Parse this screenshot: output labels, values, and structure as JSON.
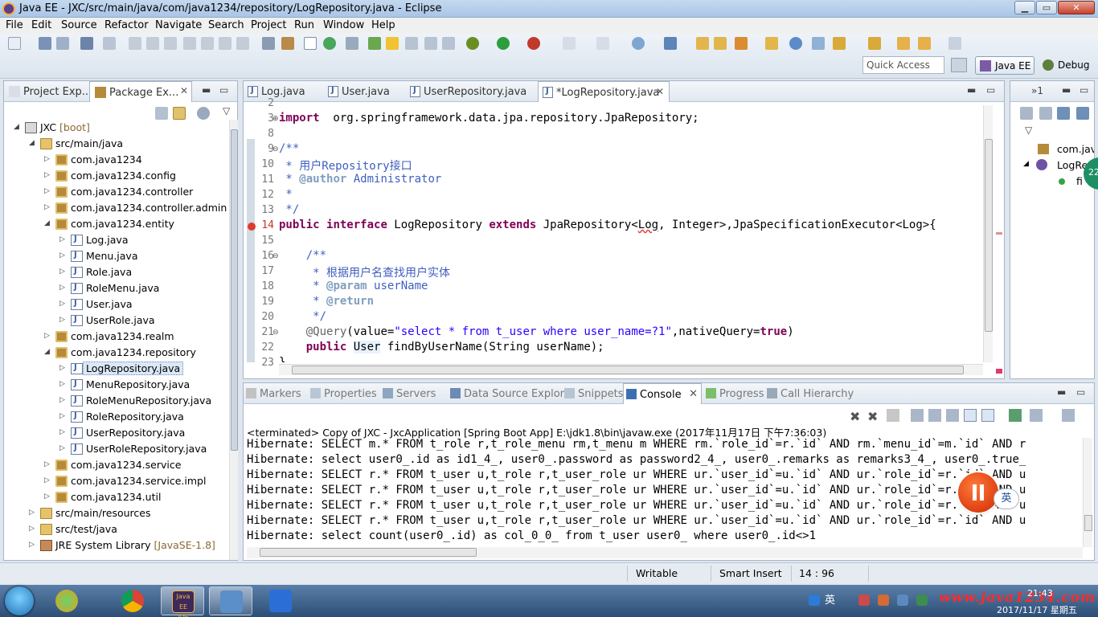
{
  "window": {
    "title": "Java EE - JXC/src/main/java/com/java1234/repository/LogRepository.java - Eclipse",
    "min": "▁",
    "max": "▭",
    "close": "✕"
  },
  "menu": [
    "File",
    "Edit",
    "Source",
    "Refactor",
    "Navigate",
    "Search",
    "Project",
    "Run",
    "Window",
    "Help"
  ],
  "toolbar": {
    "quick_access": "Quick Access",
    "perspective_javaee": "Java EE",
    "perspective_debug": "Debug"
  },
  "left_panel": {
    "tabs": [
      {
        "label": "Project Exp...",
        "active": false
      },
      {
        "label": "Package Ex...",
        "active": true
      }
    ],
    "close": "✕",
    "tree": [
      {
        "label": "JXC",
        "suffix": " [boot]",
        "indent": 0,
        "twisty": "◢",
        "icon": "project"
      },
      {
        "label": "src/main/java",
        "indent": 1,
        "twisty": "◢",
        "icon": "folder"
      },
      {
        "label": "com.java1234",
        "indent": 2,
        "twisty": "▷",
        "icon": "package"
      },
      {
        "label": "com.java1234.config",
        "indent": 2,
        "twisty": "▷",
        "icon": "package"
      },
      {
        "label": "com.java1234.controller",
        "indent": 2,
        "twisty": "▷",
        "icon": "package"
      },
      {
        "label": "com.java1234.controller.admin",
        "indent": 2,
        "twisty": "▷",
        "icon": "package"
      },
      {
        "label": "com.java1234.entity",
        "indent": 2,
        "twisty": "◢",
        "icon": "package"
      },
      {
        "label": "Log.java",
        "indent": 3,
        "twisty": "▷",
        "icon": "java"
      },
      {
        "label": "Menu.java",
        "indent": 3,
        "twisty": "▷",
        "icon": "java"
      },
      {
        "label": "Role.java",
        "indent": 3,
        "twisty": "▷",
        "icon": "java"
      },
      {
        "label": "RoleMenu.java",
        "indent": 3,
        "twisty": "▷",
        "icon": "java"
      },
      {
        "label": "User.java",
        "indent": 3,
        "twisty": "▷",
        "icon": "java"
      },
      {
        "label": "UserRole.java",
        "indent": 3,
        "twisty": "▷",
        "icon": "java"
      },
      {
        "label": "com.java1234.realm",
        "indent": 2,
        "twisty": "▷",
        "icon": "package"
      },
      {
        "label": "com.java1234.repository",
        "indent": 2,
        "twisty": "◢",
        "icon": "package"
      },
      {
        "label": "LogRepository.java",
        "indent": 3,
        "twisty": "▷",
        "icon": "java",
        "selected": true
      },
      {
        "label": "MenuRepository.java",
        "indent": 3,
        "twisty": "▷",
        "icon": "java"
      },
      {
        "label": "RoleMenuRepository.java",
        "indent": 3,
        "twisty": "▷",
        "icon": "java"
      },
      {
        "label": "RoleRepository.java",
        "indent": 3,
        "twisty": "▷",
        "icon": "java"
      },
      {
        "label": "UserRepository.java",
        "indent": 3,
        "twisty": "▷",
        "icon": "java"
      },
      {
        "label": "UserRoleRepository.java",
        "indent": 3,
        "twisty": "▷",
        "icon": "java"
      },
      {
        "label": "com.java1234.service",
        "indent": 2,
        "twisty": "▷",
        "icon": "package"
      },
      {
        "label": "com.java1234.service.impl",
        "indent": 2,
        "twisty": "▷",
        "icon": "package"
      },
      {
        "label": "com.java1234.util",
        "indent": 2,
        "twisty": "▷",
        "icon": "package"
      },
      {
        "label": "src/main/resources",
        "indent": 1,
        "twisty": "▷",
        "icon": "folder"
      },
      {
        "label": "src/test/java",
        "indent": 1,
        "twisty": "▷",
        "icon": "folder"
      },
      {
        "label": "JRE System Library",
        "suffix": " [JavaSE-1.8]",
        "indent": 1,
        "twisty": "▷",
        "icon": "library"
      }
    ]
  },
  "editor": {
    "tabs": [
      {
        "label": "Log.java",
        "active": false
      },
      {
        "label": "User.java",
        "active": false
      },
      {
        "label": "UserRepository.java",
        "active": false
      },
      {
        "label": "*LogRepository.java",
        "active": true
      }
    ],
    "close": "✕",
    "lines": [
      {
        "no": "2",
        "fold": "",
        "tokens": []
      },
      {
        "no": "3",
        "fold": "⊕",
        "tokens": [
          [
            "kw",
            "import"
          ],
          [
            "",
            "  org.springframework.data.jpa.repository.JpaRepository;"
          ]
        ]
      },
      {
        "no": "8",
        "fold": "",
        "tokens": []
      },
      {
        "no": "9",
        "fold": "⊖",
        "tokens": [
          [
            "cm",
            "/**"
          ]
        ]
      },
      {
        "no": "10",
        "fold": "",
        "tokens": [
          [
            "cm",
            " * 用户Repository接口"
          ]
        ]
      },
      {
        "no": "11",
        "fold": "",
        "tokens": [
          [
            "cm",
            " * "
          ],
          [
            "tag",
            "@author"
          ],
          [
            "cm",
            " Administrator"
          ]
        ]
      },
      {
        "no": "12",
        "fold": "",
        "tokens": [
          [
            "cm",
            " *"
          ]
        ]
      },
      {
        "no": "13",
        "fold": "",
        "tokens": [
          [
            "cm",
            " */"
          ]
        ]
      },
      {
        "no": "14",
        "fold": "",
        "error": true,
        "tokens": [
          [
            "kw",
            "public"
          ],
          [
            "",
            " "
          ],
          [
            "kw",
            "interface"
          ],
          [
            "",
            " LogRepository "
          ],
          [
            "kw",
            "extends"
          ],
          [
            "",
            " JpaRepository<"
          ],
          [
            "squig",
            "Log"
          ],
          [
            "",
            ", Integer>,JpaSpecificationExecutor<Log>{"
          ]
        ]
      },
      {
        "no": "15",
        "fold": "",
        "tokens": []
      },
      {
        "no": "16",
        "fold": "⊖",
        "tokens": [
          [
            "cm",
            "    /**"
          ]
        ]
      },
      {
        "no": "17",
        "fold": "",
        "tokens": [
          [
            "cm",
            "     * 根据用户名查找用户实体"
          ]
        ]
      },
      {
        "no": "18",
        "fold": "",
        "tokens": [
          [
            "cm",
            "     * "
          ],
          [
            "tag",
            "@param"
          ],
          [
            "cm",
            " userName"
          ]
        ]
      },
      {
        "no": "19",
        "fold": "",
        "tokens": [
          [
            "cm",
            "     * "
          ],
          [
            "tag",
            "@return"
          ]
        ]
      },
      {
        "no": "20",
        "fold": "",
        "tokens": [
          [
            "cm",
            "     */"
          ]
        ]
      },
      {
        "no": "21",
        "fold": "⊖",
        "tokens": [
          [
            "an",
            "    @Query"
          ],
          [
            "",
            "(value="
          ],
          [
            "str",
            "\"select * from t_user where user_name=?1\""
          ],
          [
            "",
            ",nativeQuery="
          ],
          [
            "kw",
            "true"
          ],
          [
            "",
            ")"
          ]
        ]
      },
      {
        "no": "22",
        "fold": "",
        "tokens": [
          [
            "",
            "    "
          ],
          [
            "kw",
            "public"
          ],
          [
            "",
            " "
          ],
          [
            "hl",
            "User"
          ],
          [
            "",
            " findByUserName(String userName);"
          ]
        ]
      },
      {
        "no": "23",
        "fold": "",
        "tokens": [
          [
            "",
            "}"
          ]
        ]
      }
    ]
  },
  "outline": {
    "tab": "»1",
    "rows": [
      {
        "label": "com.jav",
        "indent": 0
      },
      {
        "label": "LogRe",
        "indent": 0
      },
      {
        "label": "fi",
        "indent": 1
      }
    ]
  },
  "console": {
    "tabs": [
      {
        "label": "Markers",
        "active": false
      },
      {
        "label": "Properties",
        "active": false
      },
      {
        "label": "Servers",
        "active": false
      },
      {
        "label": "Data Source Explorer",
        "active": false
      },
      {
        "label": "Snippets",
        "active": false
      },
      {
        "label": "Console",
        "active": true
      },
      {
        "label": "Progress",
        "active": false
      },
      {
        "label": "Call Hierarchy",
        "active": false
      }
    ],
    "close": "✕",
    "status": "<terminated> Copy of JXC - JxcApplication [Spring Boot App] E:\\jdk1.8\\bin\\javaw.exe (2017年11月17日 下午7:36:03)",
    "lines": [
      "Hibernate: SELECT m.* FROM t_role r,t_role_menu rm,t_menu m WHERE rm.`role_id`=r.`id` AND rm.`menu_id`=m.`id` AND r",
      "Hibernate: select user0_.id as id1_4_, user0_.password as password2_4_, user0_.remarks as remarks3_4_, user0_.true_",
      "Hibernate: SELECT r.* FROM t_user u,t_role r,t_user_role ur WHERE ur.`user_id`=u.`id` AND ur.`role_id`=r.`id` AND u",
      "Hibernate: SELECT r.* FROM t_user u,t_role r,t_user_role ur WHERE ur.`user_id`=u.`id` AND ur.`role_id`=r.`id` AND u",
      "Hibernate: SELECT r.* FROM t_user u,t_role r,t_user_role ur WHERE ur.`user_id`=u.`id` AND ur.`role_id`=r.`id` AND u",
      "Hibernate: SELECT r.* FROM t_user u,t_role r,t_user_role ur WHERE ur.`user_id`=u.`id` AND ur.`role_id`=r.`id` AND u",
      "Hibernate: select count(user0_.id) as col_0_0_ from t_user user0_ where user0_.id<>1"
    ]
  },
  "overlay": {
    "lang": "英",
    "side_badge": "22"
  },
  "status_bar": {
    "writable": "Writable",
    "insert_mode": "Smart Insert",
    "position": "14 : 96"
  },
  "taskbar": {
    "ime": "英",
    "watermark": "www.java1234.com",
    "time": "21:43",
    "date": "2017/11/17 星期五",
    "eclipse_label": "Java EE IDE"
  }
}
